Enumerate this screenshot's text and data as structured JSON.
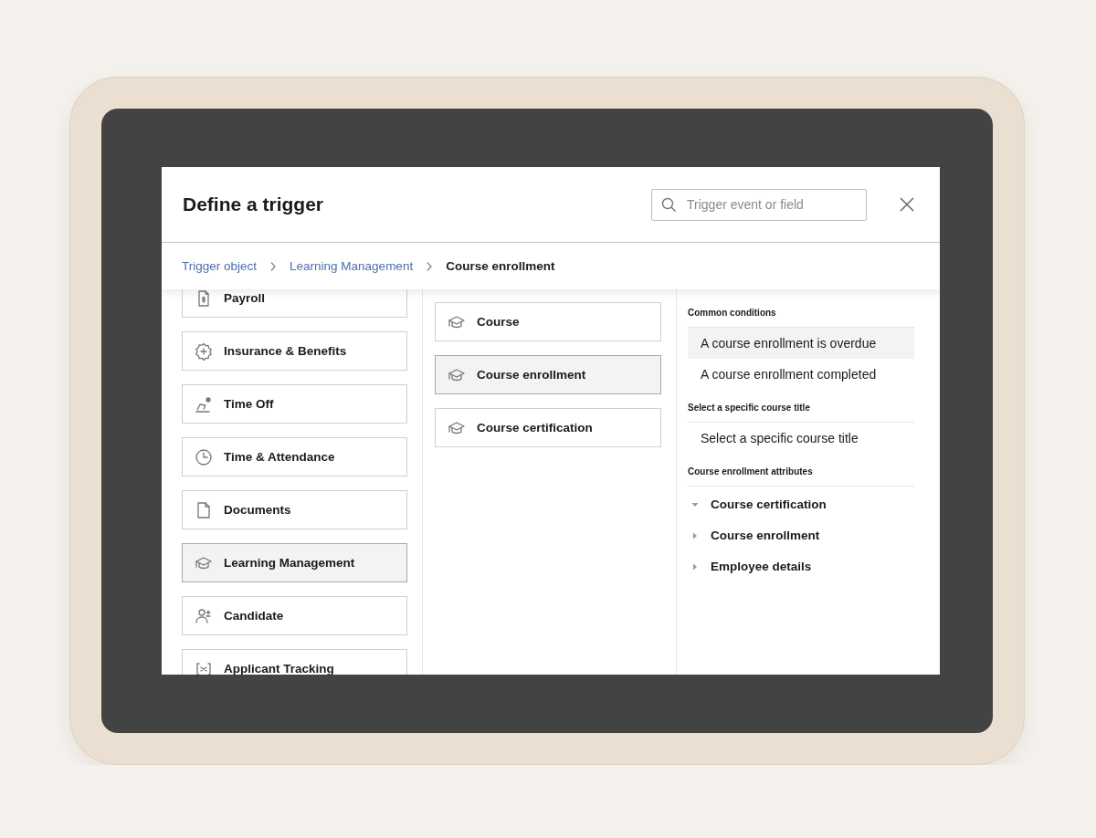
{
  "dialog": {
    "title": "Define a trigger",
    "search": {
      "placeholder": "Trigger event or field"
    }
  },
  "breadcrumb": [
    {
      "label": "Trigger object",
      "kind": "link"
    },
    {
      "label": "Learning Management",
      "kind": "link"
    },
    {
      "label": "Course enrollment",
      "kind": "current"
    }
  ],
  "objects": [
    {
      "label": "Payroll",
      "selected": false
    },
    {
      "label": "Insurance & Benefits",
      "selected": false
    },
    {
      "label": "Time Off",
      "selected": false
    },
    {
      "label": "Time & Attendance",
      "selected": false
    },
    {
      "label": "Documents",
      "selected": false
    },
    {
      "label": "Learning Management",
      "selected": true
    },
    {
      "label": "Candidate",
      "selected": false
    },
    {
      "label": "Applicant Tracking",
      "selected": false
    }
  ],
  "events": [
    {
      "label": "Course",
      "selected": false
    },
    {
      "label": "Course enrollment",
      "selected": true
    },
    {
      "label": "Course certification",
      "selected": false
    }
  ],
  "conditions": [
    {
      "heading": "Common conditions",
      "items": [
        {
          "label": "A course enrollment is overdue",
          "selected": true
        },
        {
          "label": "A course enrollment completed",
          "selected": false
        }
      ]
    },
    {
      "heading": "Select a specific course title",
      "items": [
        {
          "label": "Select a specific course title",
          "selected": false
        }
      ]
    }
  ],
  "attributes": {
    "heading": "Course enrollment attributes",
    "items": [
      {
        "label": "Course certification",
        "expanded": true
      },
      {
        "label": "Course enrollment",
        "expanded": false
      },
      {
        "label": "Employee details",
        "expanded": false
      }
    ]
  }
}
